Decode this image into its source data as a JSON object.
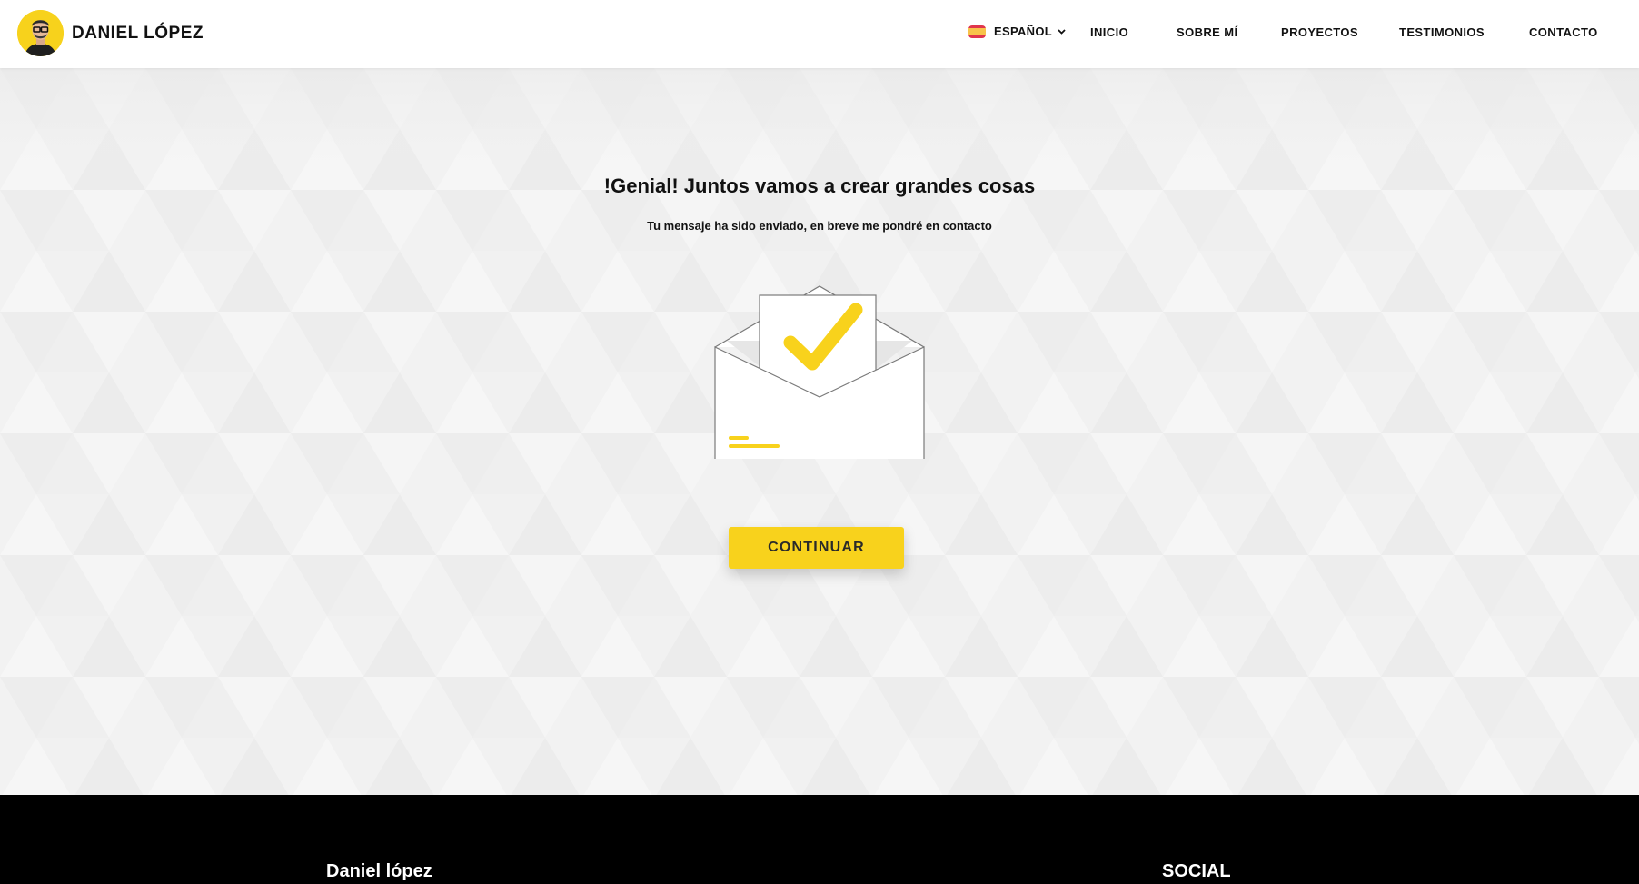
{
  "header": {
    "brand_name": "DANIEL LÓPEZ",
    "language": {
      "label": "ESPAÑOL",
      "flag": "spain-flag"
    },
    "nav": [
      {
        "label": "INICIO"
      },
      {
        "label": "SOBRE MÍ"
      },
      {
        "label": "PROYECTOS"
      },
      {
        "label": "TESTIMONIOS"
      },
      {
        "label": "CONTACTO"
      }
    ]
  },
  "main": {
    "title": "!Genial! Juntos vamos a crear grandes cosas",
    "subtitle": "Tu mensaje ha sido enviado, en breve me pondré en contacto",
    "illustration_icon": "envelope-check-icon",
    "cta_label": "CONTINUAR"
  },
  "footer": {
    "brand_heading": "Daniel lópez",
    "social_heading": "SOCIAL"
  },
  "colors": {
    "accent": "#f8d21c",
    "header_bg": "#ffffff",
    "footer_bg": "#000000",
    "page_bg": "#f2f2f2"
  }
}
